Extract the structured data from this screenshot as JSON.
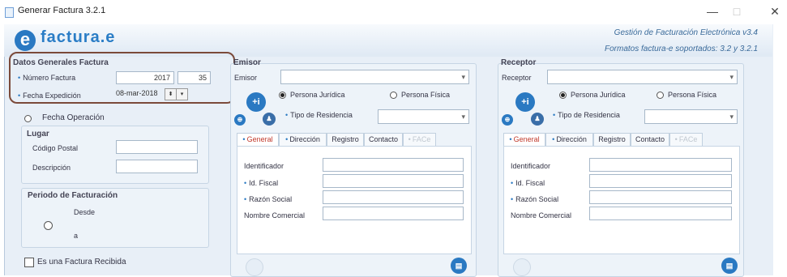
{
  "window": {
    "title": "Generar Factura 3.2.1",
    "min": "—",
    "max": "□",
    "close": "✕"
  },
  "header": {
    "logo_letter": "e",
    "logo_text": "factura.e",
    "info_line1": "Gestión de Facturación Electrónica v3.4",
    "info_line2": "Formatos factura-e soportados: 3.2 y 3.2.1"
  },
  "datos_generales": {
    "title": "Datos Generales Factura",
    "numero_label": "Número Factura",
    "numero_serie": "2017",
    "numero_num": "35",
    "fecha_label": "Fecha Expedición",
    "fecha_value": "08-mar-2018",
    "fecha_operacion_label": "Fecha Operación"
  },
  "lugar": {
    "title": "Lugar",
    "cp_label": "Código Postal",
    "desc_label": "Descripción",
    "cp_value": "",
    "desc_value": ""
  },
  "periodo": {
    "title": "Periodo de Facturación",
    "desde": "Desde",
    "a": "a"
  },
  "recibida_label": "Es una Factura Recibida",
  "emisor": {
    "title": "Emisor",
    "select_label": "Emisor",
    "juridica": "Persona Jurídica",
    "fisica": "Persona Física",
    "residencia_label": "Tipo de Residencia",
    "tabs": [
      "General",
      "Dirección",
      "Registro",
      "Contacto",
      "FACe"
    ],
    "fields": [
      "Identificador",
      "Id. Fiscal",
      "Razón Social",
      "Nombre Comercial"
    ]
  },
  "receptor": {
    "title": "Receptor",
    "select_label": "Receptor",
    "juridica": "Persona Jurídica",
    "fisica": "Persona Física",
    "residencia_label": "Tipo de Residencia",
    "tabs": [
      "General",
      "Dirección",
      "Registro",
      "Contacto",
      "FACe"
    ],
    "fields": [
      "Identificador",
      "Id. Fiscal",
      "Razón Social",
      "Nombre Comercial"
    ]
  },
  "colors": {
    "accent": "#2a79c2",
    "highlight": "#7b4a3a",
    "active_tab": "#c0392b"
  }
}
